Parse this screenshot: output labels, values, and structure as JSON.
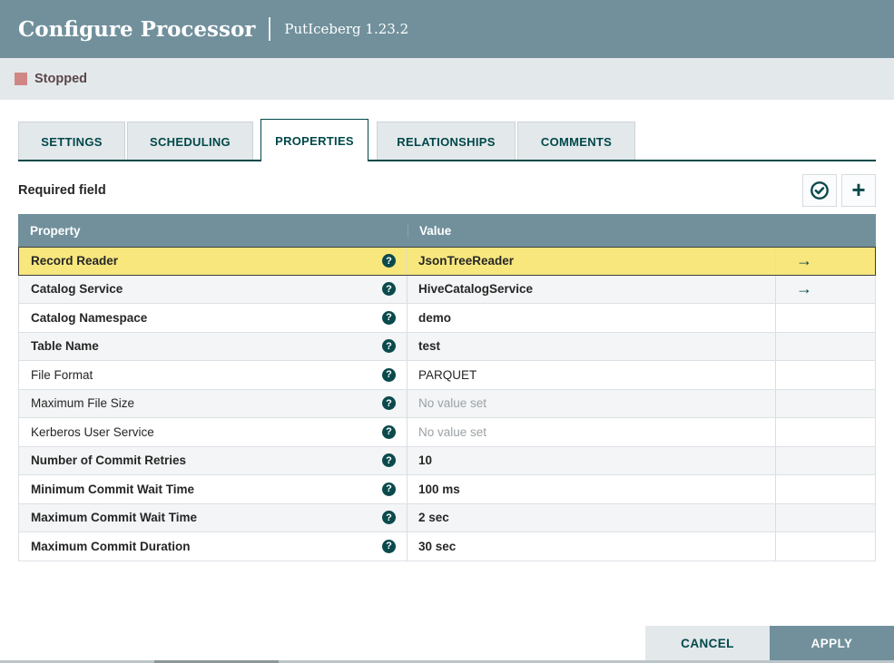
{
  "window": {
    "title": "Configure Processor",
    "subtitle": "PutIceberg 1.23.2"
  },
  "status": {
    "label": "Stopped",
    "color": "#d18686"
  },
  "tabs": [
    {
      "label": "SETTINGS",
      "active": false
    },
    {
      "label": "SCHEDULING",
      "active": false
    },
    {
      "label": "PROPERTIES",
      "active": true
    },
    {
      "label": "RELATIONSHIPS",
      "active": false
    },
    {
      "label": "COMMENTS",
      "active": false
    }
  ],
  "properties_panel": {
    "required_label": "Required field",
    "verify_button_icon": "check-circle",
    "add_button_icon": "plus"
  },
  "table": {
    "headers": {
      "property": "Property",
      "value": "Value"
    },
    "rows": [
      {
        "property": "Record Reader",
        "value": "JsonTreeReader",
        "required": true,
        "no_value": false,
        "link": true,
        "selected": true
      },
      {
        "property": "Catalog Service",
        "value": "HiveCatalogService",
        "required": true,
        "no_value": false,
        "link": true,
        "selected": false
      },
      {
        "property": "Catalog Namespace",
        "value": "demo",
        "required": true,
        "no_value": false,
        "link": false,
        "selected": false
      },
      {
        "property": "Table Name",
        "value": "test",
        "required": true,
        "no_value": false,
        "link": false,
        "selected": false
      },
      {
        "property": "File Format",
        "value": "PARQUET",
        "required": false,
        "no_value": false,
        "link": false,
        "selected": false
      },
      {
        "property": "Maximum File Size",
        "value": "No value set",
        "required": false,
        "no_value": true,
        "link": false,
        "selected": false
      },
      {
        "property": "Kerberos User Service",
        "value": "No value set",
        "required": false,
        "no_value": true,
        "link": false,
        "selected": false
      },
      {
        "property": "Number of Commit Retries",
        "value": "10",
        "required": true,
        "no_value": false,
        "link": false,
        "selected": false
      },
      {
        "property": "Minimum Commit Wait Time",
        "value": "100 ms",
        "required": true,
        "no_value": false,
        "link": false,
        "selected": false
      },
      {
        "property": "Maximum Commit Wait Time",
        "value": "2 sec",
        "required": true,
        "no_value": false,
        "link": false,
        "selected": false
      },
      {
        "property": "Maximum Commit Duration",
        "value": "30 sec",
        "required": true,
        "no_value": false,
        "link": false,
        "selected": false
      }
    ]
  },
  "footer": {
    "cancel_label": "CANCEL",
    "apply_label": "APPLY"
  },
  "colors": {
    "accent_teal": "#004849",
    "header_slate": "#71909c",
    "selected_row_yellow": "#f7e77d",
    "stopped_rose": "#d18686",
    "tab_inactive_bg": "#e3e8eb"
  }
}
